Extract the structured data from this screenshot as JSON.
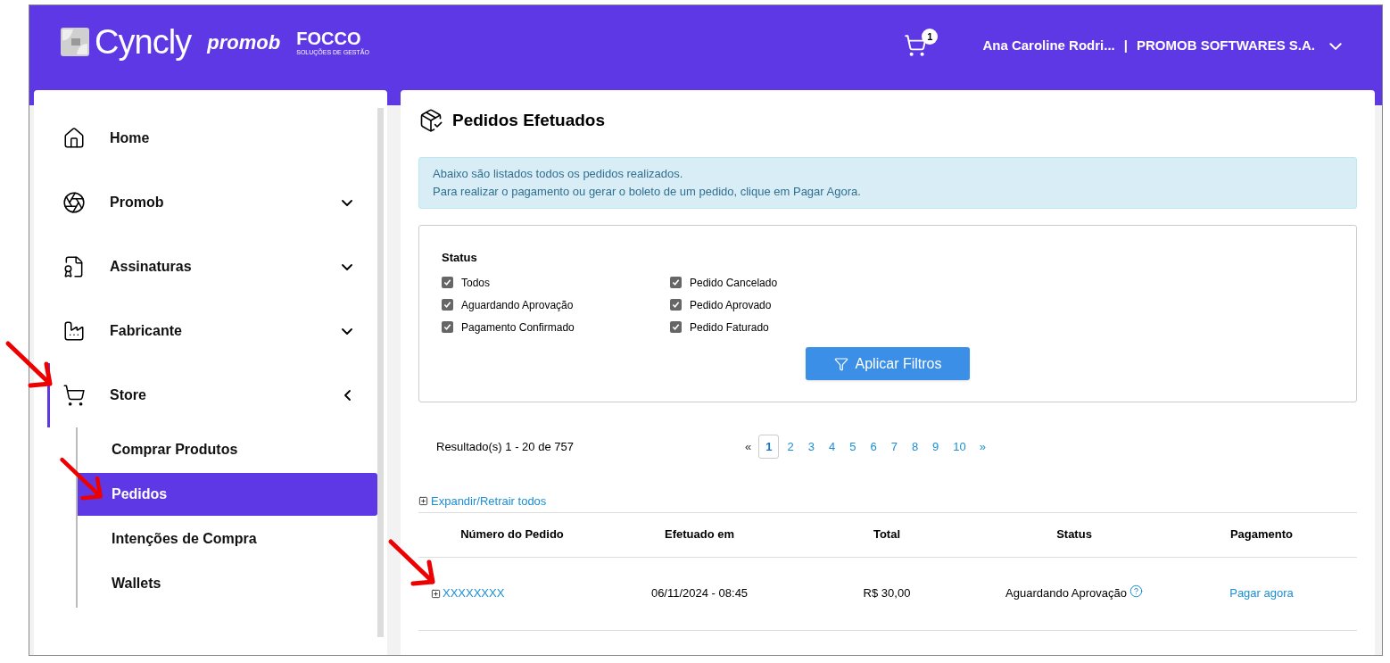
{
  "header": {
    "logos": {
      "cyncly": "Cyncly",
      "promob": "promob",
      "focco": "FOCCO",
      "focco_tagline": "SOLUÇÕES DE GESTÃO"
    },
    "cart_count": "1",
    "user": "Ana Caroline Rodri...",
    "separator": "|",
    "company": "PROMOB SOFTWARES S.A."
  },
  "sidebar": {
    "items": [
      {
        "label": "Home",
        "kind": "link"
      },
      {
        "label": "Promob",
        "kind": "group",
        "expanded": false
      },
      {
        "label": "Assinaturas",
        "kind": "group",
        "expanded": false
      },
      {
        "label": "Fabricante",
        "kind": "group",
        "expanded": false
      },
      {
        "label": "Store",
        "kind": "group",
        "expanded": true,
        "children": [
          {
            "label": "Comprar Produtos",
            "selected": false
          },
          {
            "label": "Pedidos",
            "selected": true
          },
          {
            "label": "Intenções de Compra",
            "selected": false
          },
          {
            "label": "Wallets",
            "selected": false
          }
        ]
      }
    ]
  },
  "page": {
    "title": "Pedidos Efetuados",
    "info": [
      "Abaixo são listados todos os pedidos realizados.",
      "Para realizar o pagamento ou gerar o boleto de um pedido, clique em Pagar Agora."
    ],
    "filters": {
      "title": "Status",
      "options": [
        {
          "label": "Todos",
          "checked": true
        },
        {
          "label": "Aguardando Aprovação",
          "checked": true
        },
        {
          "label": "Pagamento Confirmado",
          "checked": true
        },
        {
          "label": "Pedido Cancelado",
          "checked": true
        },
        {
          "label": "Pedido Aprovado",
          "checked": true
        },
        {
          "label": "Pedido Faturado",
          "checked": true
        }
      ],
      "apply_button": "Aplicar Filtros"
    },
    "results": "Resultado(s) 1 - 20 de 757",
    "pagination": {
      "prev": "«",
      "next": "»",
      "pages": [
        {
          "label": "1",
          "selected": true
        },
        {
          "label": "2",
          "selected": false
        },
        {
          "label": "3",
          "selected": false
        },
        {
          "label": "4",
          "selected": false
        },
        {
          "label": "5",
          "selected": false
        },
        {
          "label": "6",
          "selected": false
        },
        {
          "label": "7",
          "selected": false
        },
        {
          "label": "8",
          "selected": false
        },
        {
          "label": "9",
          "selected": false
        },
        {
          "label": "10",
          "selected": false
        }
      ]
    },
    "expand_all": "Expandir/Retrair todos",
    "table": {
      "columns": [
        "Número do Pedido",
        "Efetuado em",
        "Total",
        "Status",
        "Pagamento"
      ],
      "rows": [
        {
          "order": "XXXXXXXX",
          "date": "06/11/2024 - 08:45",
          "total": "R$ 30,00",
          "status": "Aguardando Aprovação",
          "payment": "Pagar agora"
        }
      ]
    }
  }
}
